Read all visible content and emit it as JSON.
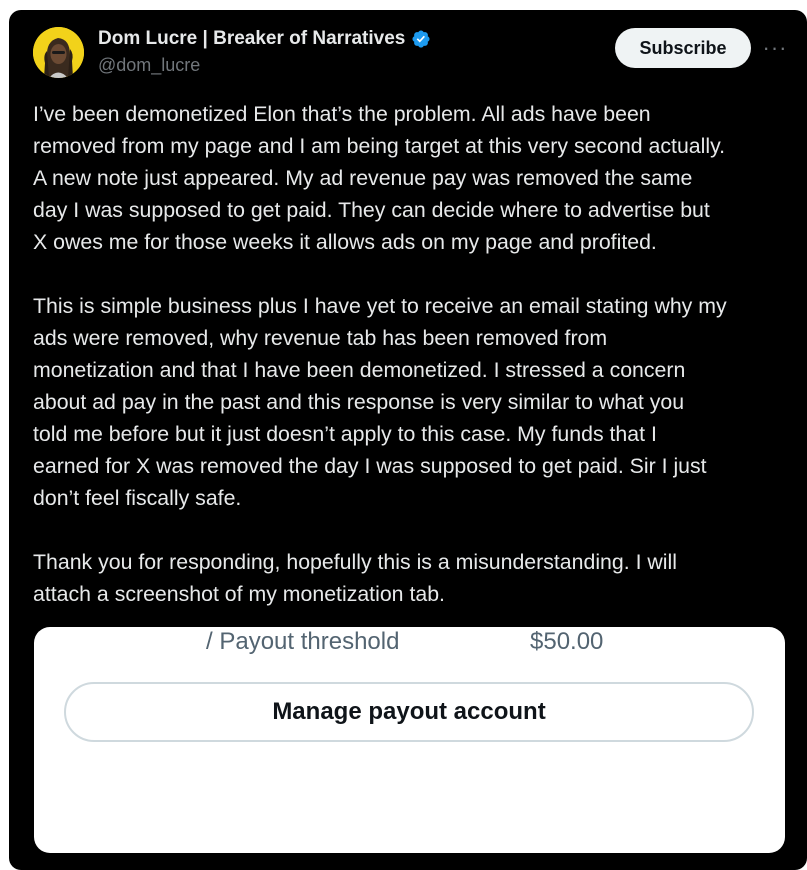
{
  "author": {
    "display_name": "Dom Lucre | Breaker of Narratives",
    "handle": "@dom_lucre",
    "verified": true
  },
  "header": {
    "subscribe_label": "Subscribe",
    "more_label": "···"
  },
  "tweet": {
    "paragraphs": [
      "I’ve been demonetized Elon that’s the problem. All ads have been\nremoved from my page and I am being target at this very second actually.\nA new note just appeared. My ad revenue pay was removed the same\nday I was supposed to get paid. They can decide where to advertise but\nX owes me for those weeks it allows ads on my page and profited.",
      "This is simple business plus I have yet to receive an email stating why my\nads were removed, why revenue tab has been removed from\nmonetization and that I have been demonetized. I stressed a concern\nabout ad pay in the past and this response is very similar to what you\ntold me before but it just doesn’t apply to this case. My funds that I\nearned for X was removed the day I was supposed to get paid. Sir I just\ndon’t feel fiscally safe.",
      "Thank you for responding, hopefully this is a misunderstanding. I will\nattach a screenshot of my monetization tab."
    ]
  },
  "media": {
    "threshold_label": "/ Payout threshold",
    "threshold_value": "$50.00",
    "manage_button_label": "Manage payout account"
  },
  "colors": {
    "background": "#000000",
    "text": "#e7e9ea",
    "secondary": "#71767b",
    "verified_blue": "#1d9bf0",
    "avatar_yellow": "#f2d21a"
  }
}
